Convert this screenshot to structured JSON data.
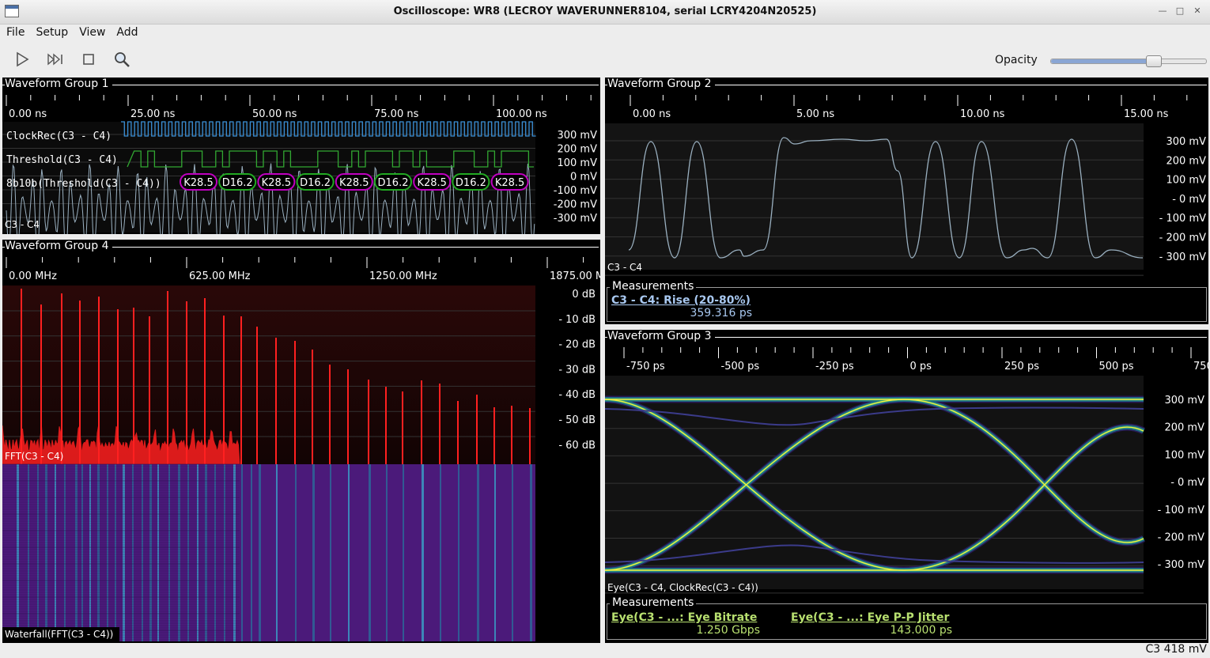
{
  "window": {
    "title": "Oscilloscope: WR8 (LECROY WAVERUNNER8104, serial LCRY4204N20525)"
  },
  "menu": [
    "File",
    "Setup",
    "View",
    "Add"
  ],
  "toolbar": {
    "opacity_label": "Opacity",
    "opacity_value": 0.66,
    "buttons": [
      "play-icon",
      "fast-forward-icon",
      "stop-icon",
      "zoom-icon"
    ]
  },
  "groups": {
    "g1": {
      "title": "Waveform Group 1",
      "ticks": [
        "0.00 ns",
        "25.00 ns",
        "50.00 ns",
        "75.00 ns",
        "100.00 ns"
      ],
      "y_labels": [
        "300  mV",
        "200  mV",
        "100  mV",
        "0  mV",
        "-100  mV",
        "-200  mV",
        "-300  mV"
      ],
      "traces": [
        "ClockRec(C3 - C4)",
        "Threshold(C3 - C4)",
        "8b10b(Threshold(C3 - C4))"
      ],
      "symbols": [
        "K28.5",
        "D16.2",
        "K28.5",
        "D16.2",
        "K28.5",
        "D16.2",
        "K28.5",
        "D16.2",
        "K28.5"
      ],
      "channel": "C3 - C4"
    },
    "g2": {
      "title": "Waveform Group 2",
      "ticks": [
        "0.00 ns",
        "5.00 ns",
        "10.00 ns",
        "15.00 ns"
      ],
      "y_labels": [
        "300  mV",
        "200  mV",
        "100  mV",
        "- 0  mV",
        "- 100  mV",
        "- 200  mV",
        "- 300  mV"
      ],
      "channel": "C3 - C4",
      "measurements_title": "Measurements",
      "measurements": [
        {
          "name": "C3 - C4: Rise (20-80%)",
          "value": "359.316 ps"
        }
      ]
    },
    "g3": {
      "title": "Waveform Group 3",
      "ticks": [
        "-750 ps",
        "-500 ps",
        "-250 ps",
        "0 ps",
        "250 ps",
        "500 ps",
        "750"
      ],
      "y_labels": [
        "300  mV",
        "200  mV",
        "100  mV",
        "- 0  mV",
        "- 100  mV",
        "- 200  mV",
        "- 300  mV"
      ],
      "channel": "Eye(C3 - C4, ClockRec(C3 - C4))",
      "measurements_title": "Measurements",
      "measurements": [
        {
          "name": "Eye(C3 - ...: Eye Bitrate",
          "value": "1.250 Gbps"
        },
        {
          "name": "Eye(C3 - ...: Eye P-P Jitter",
          "value": "143.000 ps"
        }
      ]
    },
    "g4": {
      "title": "Waveform Group 4",
      "ticks": [
        "0.00 MHz",
        "625.00 MHz",
        "1250.00 MHz",
        "1875.00 M"
      ],
      "y_labels": [
        "0  dB",
        "- 10  dB",
        "- 20  dB",
        "- 30  dB",
        "- 40  dB",
        "- 50  dB",
        "- 60  dB"
      ],
      "fft_label": "FFT(C3 - C4)",
      "waterfall_label": "Waterfall(FFT(C3 - C4))"
    }
  },
  "status": {
    "text": "C3 418 mV"
  },
  "colors": {
    "clock": "#3a8fd6",
    "threshold": "#32a832",
    "k_symbol": "#c000c0",
    "d_symbol": "#22aa22",
    "analog": "#9ab0c0",
    "fft": "#ff2020",
    "waterfall": "#4b1a7a",
    "measurement_g2": "#a8c8f0",
    "measurement_g3": "#b8e070"
  }
}
